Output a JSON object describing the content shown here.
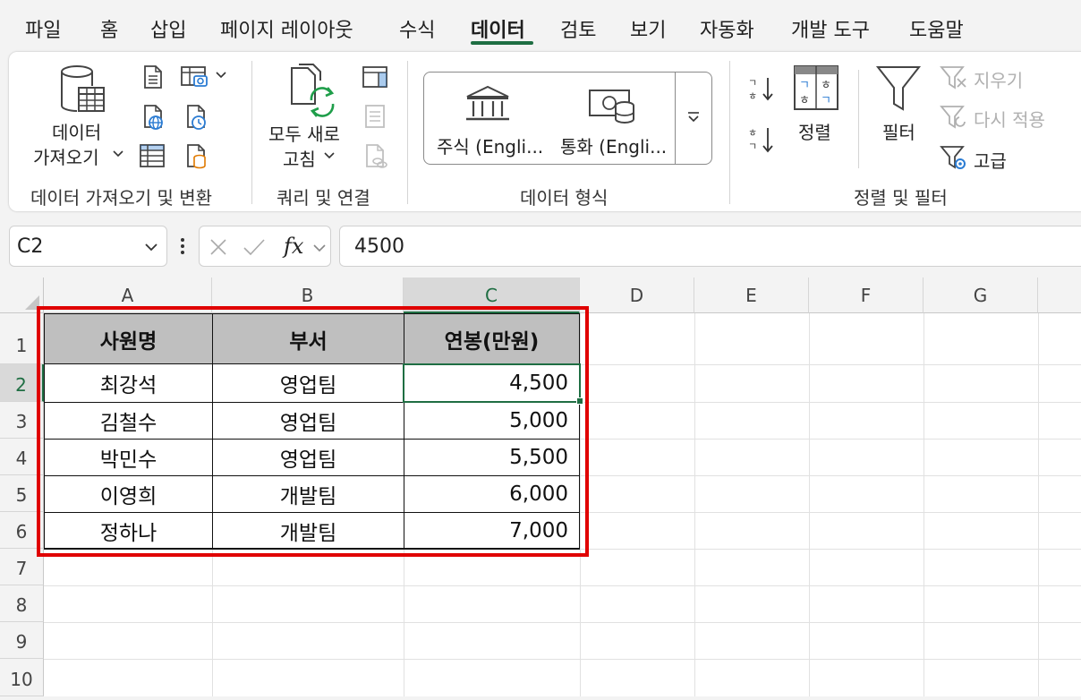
{
  "menu": {
    "items": [
      "파일",
      "홈",
      "삽입",
      "페이지 레이아웃",
      "수식",
      "데이터",
      "검토",
      "보기",
      "자동화",
      "개발 도구",
      "도움말"
    ],
    "active": "데이터"
  },
  "ribbon": {
    "get_data_line1": "데이터",
    "get_data_line2": "가져오기",
    "get_group_label": "데이터 가져오기 및 변환",
    "refresh_line1": "모두 새로",
    "refresh_line2": "고침",
    "query_group_label": "쿼리 및 연결",
    "stocks_label": "주식 (Engli...",
    "currency_label": "통화 (Engli...",
    "datatype_group_label": "데이터 형식",
    "sort_label": "정렬",
    "filter_label": "필터",
    "clear_label": "지우기",
    "reapply_label": "다시 적용",
    "advanced_label": "고급",
    "sortfilter_group_label": "정렬 및 필터"
  },
  "formula_bar": {
    "name_box": "C2",
    "fx": "fx",
    "value": "4500"
  },
  "columns": [
    "A",
    "B",
    "C",
    "D",
    "E",
    "F",
    "G"
  ],
  "rows": [
    "1",
    "2",
    "3",
    "4",
    "5",
    "6",
    "7",
    "8",
    "9",
    "10"
  ],
  "table": {
    "headers": [
      "사원명",
      "부서",
      "연봉(만원)"
    ],
    "rows": [
      [
        "최강석",
        "영업팀",
        "4,500"
      ],
      [
        "김철수",
        "영업팀",
        "5,000"
      ],
      [
        "박민수",
        "영업팀",
        "5,500"
      ],
      [
        "이영희",
        "개발팀",
        "6,000"
      ],
      [
        "정하나",
        "개발팀",
        "7,000"
      ]
    ]
  },
  "colors": {
    "accent": "#1f6e43",
    "highlight_border": "#e00000",
    "table_header_bg": "#bfbfbf"
  }
}
